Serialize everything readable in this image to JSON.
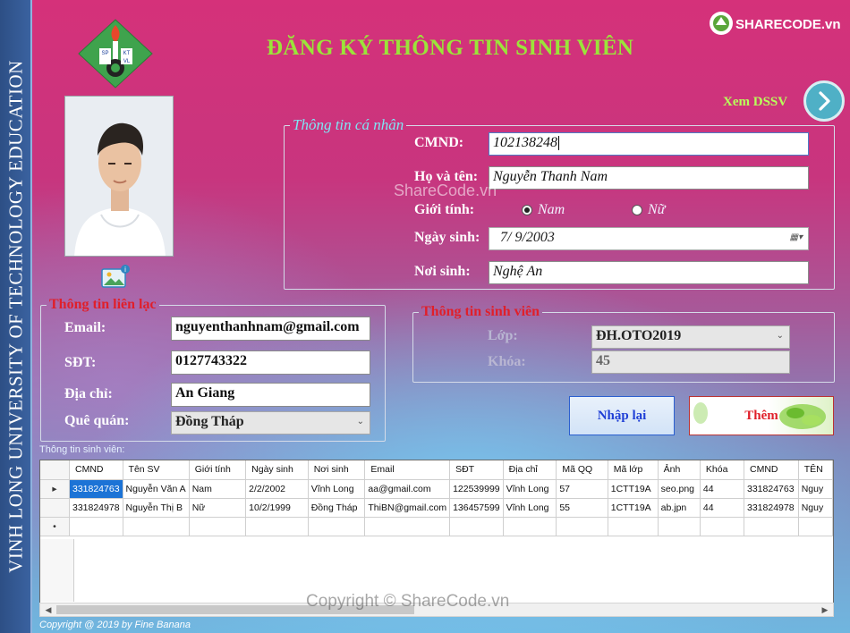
{
  "app": {
    "side_text": "VINH LONG UNIVERSITY OF TECHNOLOGY EDUCATION",
    "title": "ĐĂNG KÝ THÔNG TIN SINH VIÊN",
    "brand": "SHARECODE.vn",
    "view_list_label": "Xem DSSV",
    "logo_letters": [
      "SP",
      "KT",
      "VL"
    ]
  },
  "personal": {
    "legend": "Thông tin cá nhân",
    "id_label": "CMND:",
    "id_value": "102138248",
    "name_label": "Họ và tên:",
    "name_value": "Nguyễn Thanh Nam",
    "gender_label": "Giới tính:",
    "gender_male": "Nam",
    "gender_female": "Nữ",
    "gender_selected": "Nam",
    "dob_label": "Ngày sinh:",
    "dob_value": "7/  9/2003",
    "birthplace_label": "Nơi sinh:",
    "birthplace_value": "Nghệ An"
  },
  "contact": {
    "legend": "Thông tin liên lạc",
    "email_label": "Email:",
    "email_value": "nguyenthanhnam@gmail.com",
    "phone_label": "SĐT:",
    "phone_value": "0127743322",
    "address_label": "Địa chỉ:",
    "address_value": "An Giang",
    "hometown_label": "Quê quán:",
    "hometown_value": "Đồng Tháp"
  },
  "student": {
    "legend": "Thông tin sinh viên",
    "class_label": "Lớp:",
    "class_value": "ĐH.OTO2019",
    "course_label": "Khóa:",
    "course_value": "45"
  },
  "buttons": {
    "reset": "Nhập lại",
    "add": "Thêm"
  },
  "grid": {
    "caption": "Thông tin sinh viên:",
    "columns": [
      "CMND",
      "Tên SV",
      "Giới tính",
      "Ngày sinh",
      "Nơi sinh",
      "Email",
      "SĐT",
      "Địa chỉ",
      "Mã QQ",
      "Mã lớp",
      "Ảnh",
      "Khóa",
      "CMND",
      "TÊN"
    ],
    "rows": [
      [
        "331824763",
        "Nguyễn Văn A",
        "Nam",
        "2/2/2002",
        "Vĩnh Long",
        "aa@gmail.com",
        "122539999",
        "Vĩnh Long",
        "57",
        "1CTT19A",
        "seo.png",
        "44",
        "331824763",
        "Nguy"
      ],
      [
        "331824978",
        "Nguyễn Thị B",
        "Nữ",
        "10/2/1999",
        "Đồng Tháp",
        "ThiBN@gmail.com",
        "136457599",
        "Vĩnh Long",
        "55",
        "1CTT19A",
        "ab.jpn",
        "44",
        "331824978",
        "Nguy"
      ]
    ],
    "current_row_marker": "▸",
    "new_row_marker": "•"
  },
  "footer": {
    "copyright": "Copyright @ 2019 by Fine Banana",
    "watermark_center": "ShareCode.vn",
    "watermark_bottom": "Copyright © ShareCode.vn"
  },
  "colors": {
    "title": "#9be43a",
    "legend_red": "#e01f2a",
    "legend_cyan": "#7fe6f5",
    "selection": "#1c73d6"
  }
}
